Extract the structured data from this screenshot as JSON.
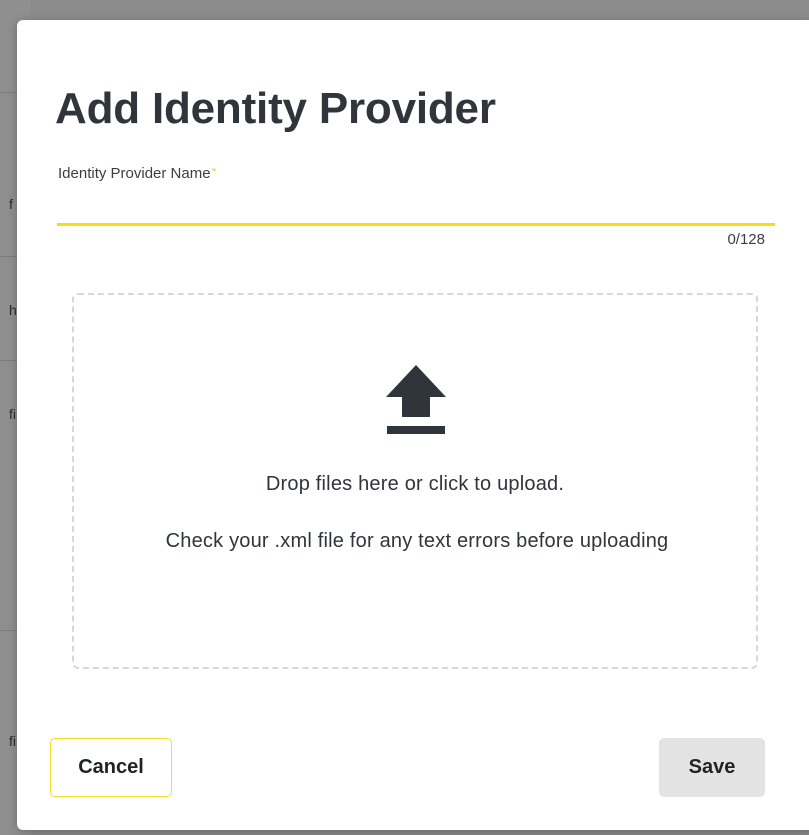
{
  "background": {
    "row_chars": [
      "f",
      "h",
      "fi",
      "fi"
    ]
  },
  "modal": {
    "title": "Add Identity Provider",
    "name_field": {
      "label": "Identity Provider Name",
      "required_mark": "*",
      "value": "",
      "placeholder": "",
      "count": "0/128"
    },
    "dropzone": {
      "icon": "upload-icon",
      "primary_text": "Drop files here or click to upload.",
      "hint_text": "Check your .xml file for any text errors before uploading"
    },
    "buttons": {
      "cancel": "Cancel",
      "save": "Save"
    }
  },
  "colors": {
    "accent": "#f4df16",
    "text": "#2f353b",
    "save_bg": "#e3e3e3",
    "dropzone_border": "#d8d8d8"
  }
}
